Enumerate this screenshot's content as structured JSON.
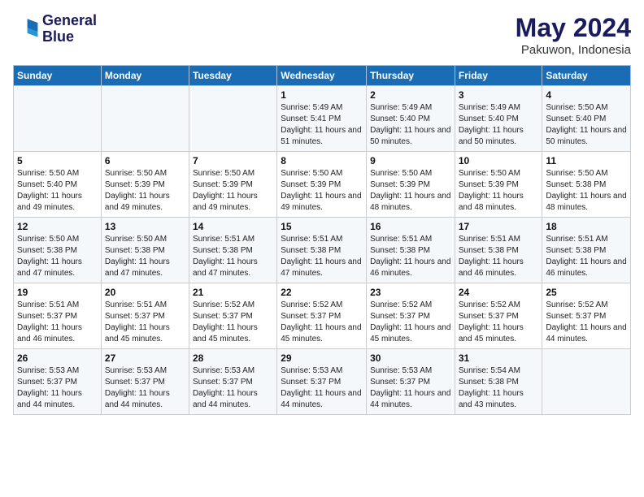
{
  "logo": {
    "line1": "General",
    "line2": "Blue"
  },
  "title": "May 2024",
  "location": "Pakuwon, Indonesia",
  "weekdays": [
    "Sunday",
    "Monday",
    "Tuesday",
    "Wednesday",
    "Thursday",
    "Friday",
    "Saturday"
  ],
  "weeks": [
    [
      {
        "day": "",
        "info": ""
      },
      {
        "day": "",
        "info": ""
      },
      {
        "day": "",
        "info": ""
      },
      {
        "day": "1",
        "info": "Sunrise: 5:49 AM\nSunset: 5:41 PM\nDaylight: 11 hours and 51 minutes."
      },
      {
        "day": "2",
        "info": "Sunrise: 5:49 AM\nSunset: 5:40 PM\nDaylight: 11 hours and 50 minutes."
      },
      {
        "day": "3",
        "info": "Sunrise: 5:49 AM\nSunset: 5:40 PM\nDaylight: 11 hours and 50 minutes."
      },
      {
        "day": "4",
        "info": "Sunrise: 5:50 AM\nSunset: 5:40 PM\nDaylight: 11 hours and 50 minutes."
      }
    ],
    [
      {
        "day": "5",
        "info": "Sunrise: 5:50 AM\nSunset: 5:40 PM\nDaylight: 11 hours and 49 minutes."
      },
      {
        "day": "6",
        "info": "Sunrise: 5:50 AM\nSunset: 5:39 PM\nDaylight: 11 hours and 49 minutes."
      },
      {
        "day": "7",
        "info": "Sunrise: 5:50 AM\nSunset: 5:39 PM\nDaylight: 11 hours and 49 minutes."
      },
      {
        "day": "8",
        "info": "Sunrise: 5:50 AM\nSunset: 5:39 PM\nDaylight: 11 hours and 49 minutes."
      },
      {
        "day": "9",
        "info": "Sunrise: 5:50 AM\nSunset: 5:39 PM\nDaylight: 11 hours and 48 minutes."
      },
      {
        "day": "10",
        "info": "Sunrise: 5:50 AM\nSunset: 5:39 PM\nDaylight: 11 hours and 48 minutes."
      },
      {
        "day": "11",
        "info": "Sunrise: 5:50 AM\nSunset: 5:38 PM\nDaylight: 11 hours and 48 minutes."
      }
    ],
    [
      {
        "day": "12",
        "info": "Sunrise: 5:50 AM\nSunset: 5:38 PM\nDaylight: 11 hours and 47 minutes."
      },
      {
        "day": "13",
        "info": "Sunrise: 5:50 AM\nSunset: 5:38 PM\nDaylight: 11 hours and 47 minutes."
      },
      {
        "day": "14",
        "info": "Sunrise: 5:51 AM\nSunset: 5:38 PM\nDaylight: 11 hours and 47 minutes."
      },
      {
        "day": "15",
        "info": "Sunrise: 5:51 AM\nSunset: 5:38 PM\nDaylight: 11 hours and 47 minutes."
      },
      {
        "day": "16",
        "info": "Sunrise: 5:51 AM\nSunset: 5:38 PM\nDaylight: 11 hours and 46 minutes."
      },
      {
        "day": "17",
        "info": "Sunrise: 5:51 AM\nSunset: 5:38 PM\nDaylight: 11 hours and 46 minutes."
      },
      {
        "day": "18",
        "info": "Sunrise: 5:51 AM\nSunset: 5:38 PM\nDaylight: 11 hours and 46 minutes."
      }
    ],
    [
      {
        "day": "19",
        "info": "Sunrise: 5:51 AM\nSunset: 5:37 PM\nDaylight: 11 hours and 46 minutes."
      },
      {
        "day": "20",
        "info": "Sunrise: 5:51 AM\nSunset: 5:37 PM\nDaylight: 11 hours and 45 minutes."
      },
      {
        "day": "21",
        "info": "Sunrise: 5:52 AM\nSunset: 5:37 PM\nDaylight: 11 hours and 45 minutes."
      },
      {
        "day": "22",
        "info": "Sunrise: 5:52 AM\nSunset: 5:37 PM\nDaylight: 11 hours and 45 minutes."
      },
      {
        "day": "23",
        "info": "Sunrise: 5:52 AM\nSunset: 5:37 PM\nDaylight: 11 hours and 45 minutes."
      },
      {
        "day": "24",
        "info": "Sunrise: 5:52 AM\nSunset: 5:37 PM\nDaylight: 11 hours and 45 minutes."
      },
      {
        "day": "25",
        "info": "Sunrise: 5:52 AM\nSunset: 5:37 PM\nDaylight: 11 hours and 44 minutes."
      }
    ],
    [
      {
        "day": "26",
        "info": "Sunrise: 5:53 AM\nSunset: 5:37 PM\nDaylight: 11 hours and 44 minutes."
      },
      {
        "day": "27",
        "info": "Sunrise: 5:53 AM\nSunset: 5:37 PM\nDaylight: 11 hours and 44 minutes."
      },
      {
        "day": "28",
        "info": "Sunrise: 5:53 AM\nSunset: 5:37 PM\nDaylight: 11 hours and 44 minutes."
      },
      {
        "day": "29",
        "info": "Sunrise: 5:53 AM\nSunset: 5:37 PM\nDaylight: 11 hours and 44 minutes."
      },
      {
        "day": "30",
        "info": "Sunrise: 5:53 AM\nSunset: 5:37 PM\nDaylight: 11 hours and 44 minutes."
      },
      {
        "day": "31",
        "info": "Sunrise: 5:54 AM\nSunset: 5:38 PM\nDaylight: 11 hours and 43 minutes."
      },
      {
        "day": "",
        "info": ""
      }
    ]
  ]
}
